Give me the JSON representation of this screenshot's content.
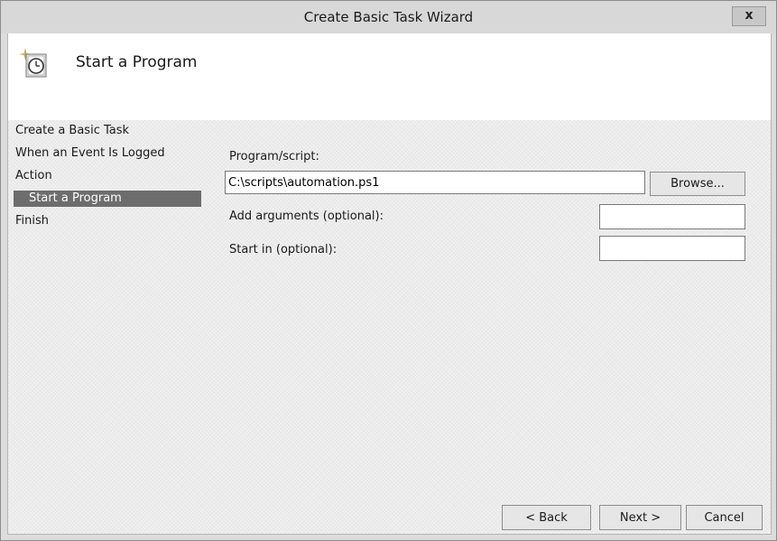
{
  "window": {
    "title": "Create Basic Task Wizard",
    "close_glyph": "x"
  },
  "header": {
    "title": "Start a Program",
    "icon": "task-scheduler-clock-icon"
  },
  "steps": [
    {
      "label": "Create a Basic Task"
    },
    {
      "label": "When an Event Is Logged"
    },
    {
      "label": "Action"
    },
    {
      "label": "Start a Program",
      "active": true
    },
    {
      "label": "Finish"
    }
  ],
  "form": {
    "program_label": "Program/script:",
    "program_value": "C:\\scripts\\automation.ps1",
    "browse_label": "Browse...",
    "arguments_label": "Add arguments (optional):",
    "arguments_value": "",
    "startin_label": "Start in (optional):",
    "startin_value": ""
  },
  "footer": {
    "back_label": "< Back",
    "next_label": "Next >",
    "cancel_label": "Cancel"
  },
  "colors": {
    "active_step_bg": "#6d6d6d",
    "header_bg": "#ffffff"
  }
}
